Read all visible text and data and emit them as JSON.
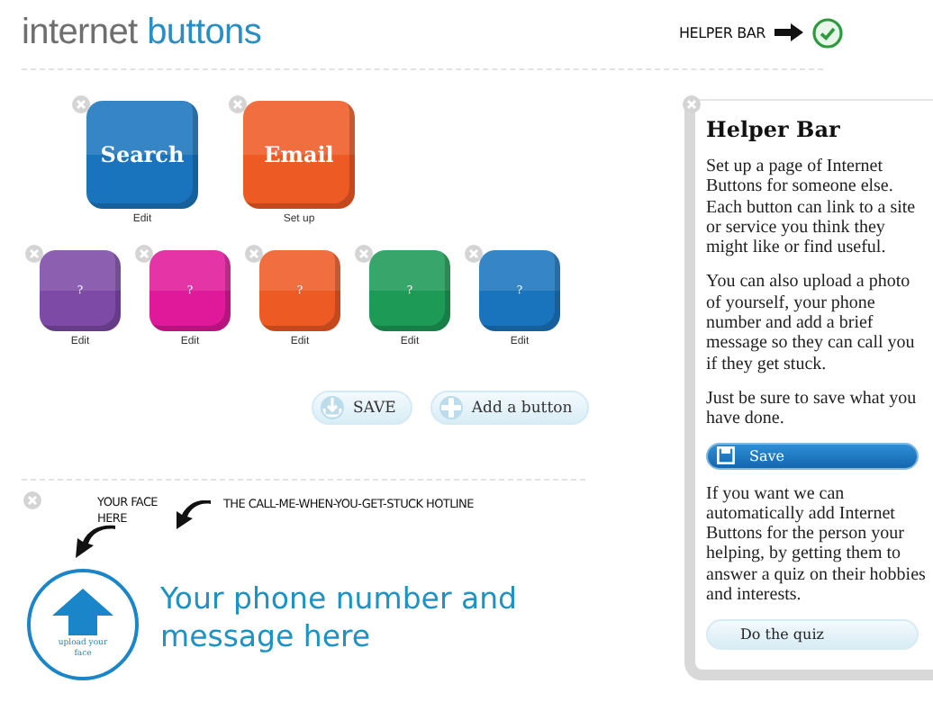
{
  "header": {
    "logo_first": "internet",
    "logo_second": "buttons",
    "helper_label": "HELPER BAR",
    "helper_on": true
  },
  "big_buttons": [
    {
      "label": "Search",
      "caption": "Edit",
      "color": "#1a74bd"
    },
    {
      "label": "Email",
      "caption": "Set up",
      "color": "#ee5a24"
    }
  ],
  "small_buttons": [
    {
      "label": "?",
      "caption": "Edit",
      "color": "#7d4aa6"
    },
    {
      "label": "?",
      "caption": "Edit",
      "color": "#e0189a"
    },
    {
      "label": "?",
      "caption": "Edit",
      "color": "#ee5a24"
    },
    {
      "label": "?",
      "caption": "Edit",
      "color": "#1d9a55"
    },
    {
      "label": "?",
      "caption": "Edit",
      "color": "#1a74bd"
    }
  ],
  "actions": [
    {
      "label": "SAVE",
      "kind": "save"
    },
    {
      "label": "Add a button",
      "kind": "add"
    }
  ],
  "contact": {
    "face_note": "YOUR FACE HERE",
    "hotline_note": "THE CALL-ME-WHEN-YOU-GET-STUCK HOTLINE",
    "upload_label": "upload your face",
    "message": "Your phone number and message here"
  },
  "helper_bar": {
    "title": "Helper Bar",
    "intro": [
      "Set up a page of Internet Buttons for someone else. Each button can link to a site or service you think they might like or find useful.",
      "You can also upload a photo of yourself, your phone number and add a brief message so they can call you if they get stuck.",
      "Just be sure to save what you have done."
    ],
    "save_label": "Save",
    "quiz_text": "If you want we can automatically add Internet Buttons for the person your helping, by getting them to answer a quiz on their hobbies and interests.",
    "quiz_label": "Do the quiz"
  }
}
